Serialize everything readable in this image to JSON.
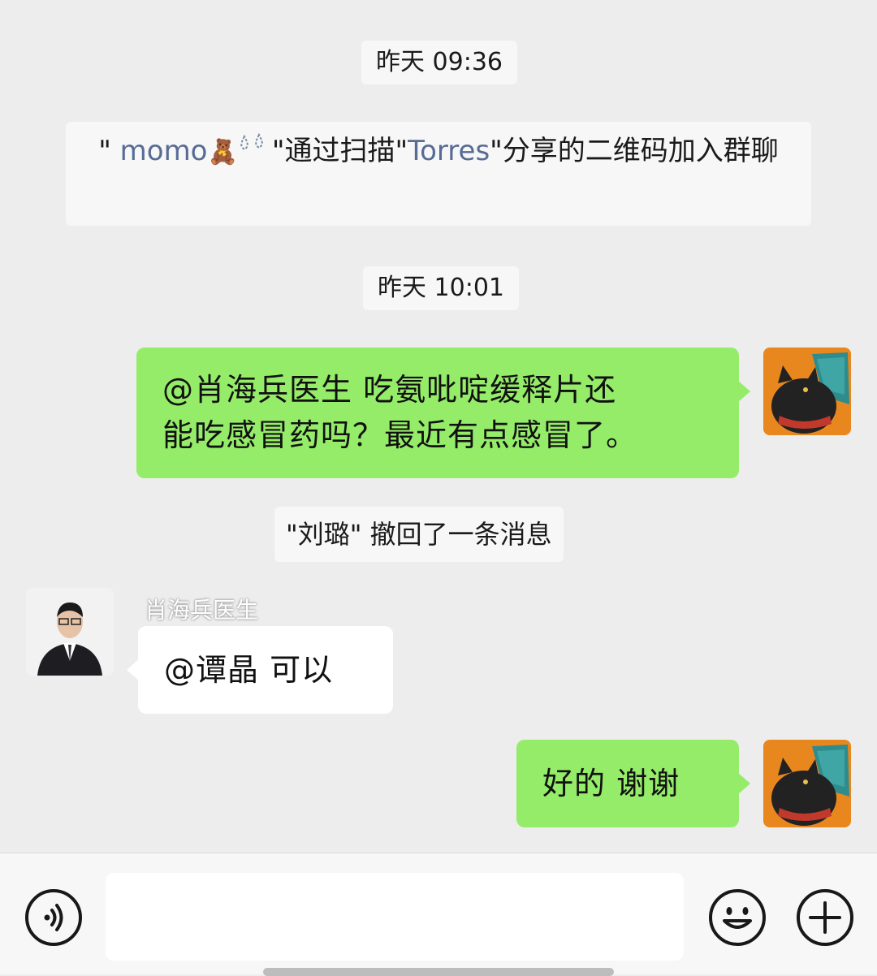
{
  "timestamps": [
    "昨天 09:36",
    "昨天 10:01"
  ],
  "join_notice": {
    "prefix": "\" ",
    "joiner": "momo",
    "joiner_emoji": "🧸",
    "suffix_mark": "\"通过扫描\"",
    "sharer": "Torres",
    "tail": "\"分享的二维码加入群聊"
  },
  "messages": [
    {
      "text_line1": "@肖海兵医生  吃氨吡啶缓释片还",
      "text_line2": "能吃感冒药吗？最近有点感冒了。"
    },
    {
      "sender": "肖海兵医生",
      "text": "@谭晶   可以"
    },
    {
      "text": "好的  谢谢"
    }
  ],
  "recall_notice": "\"刘璐\" 撤回了一条消息",
  "input": {
    "value": ""
  },
  "icons": [
    "voice-icon",
    "emoji-icon",
    "plus-icon"
  ],
  "colors": {
    "my_bubble": "#95EC69",
    "their_bubble": "#FFFFFF",
    "link": "#576B95",
    "background": "#EDEDED"
  }
}
